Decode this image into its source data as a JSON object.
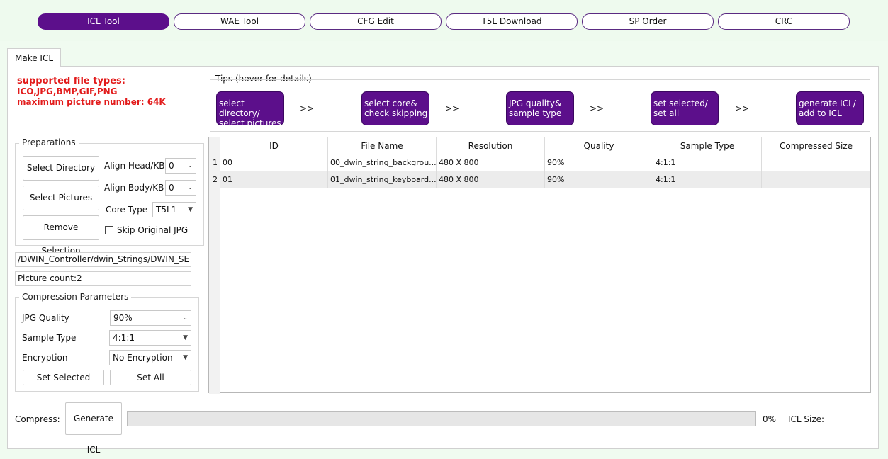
{
  "nav": {
    "items": [
      "ICL Tool",
      "WAE Tool",
      "CFG Edit",
      "T5L Download",
      "SP Order",
      "CRC"
    ],
    "active_index": 0
  },
  "tab": {
    "label": "Make ICL"
  },
  "info": {
    "line1": "supported file types:",
    "line2": "ICO,JPG,BMP,GIF,PNG",
    "line3": "maximum picture number: 64K"
  },
  "preparations": {
    "title": "Preparations",
    "select_directory": "Select Directory",
    "select_pictures": "Select Pictures",
    "remove_selection": "Remove Selection",
    "align_head_label": "Align Head/KB",
    "align_head_value": "0",
    "align_body_label": "Align Body/KB",
    "align_body_value": "0",
    "core_type_label": "Core Type",
    "core_type_value": "T5L1",
    "skip_jpg_label": "Skip Original JPG"
  },
  "path_value": "/DWIN_Controller/dwin_Strings/DWIN_SET",
  "picture_count": "Picture count:2",
  "compression": {
    "title": "Compression Parameters",
    "jpg_quality_label": "JPG Quality",
    "jpg_quality_value": "90%",
    "sample_type_label": "Sample Type",
    "sample_type_value": "4:1:1",
    "encryption_label": "Encryption",
    "encryption_value": "No Encryption",
    "set_selected": "Set Selected",
    "set_all": "Set All"
  },
  "tips": {
    "title": "Tips (hover for details)",
    "steps": [
      [
        "select directory/",
        "select pictures"
      ],
      [
        "select core&",
        "check skipping"
      ],
      [
        "JPG quality&",
        "sample type"
      ],
      [
        "set selected/",
        "set all"
      ],
      [
        "generate ICL/",
        "add to ICL"
      ]
    ],
    "arrow": ">>"
  },
  "table": {
    "columns": [
      "ID",
      "File Name",
      "Resolution",
      "Quality",
      "Sample Type",
      "Compressed Size"
    ],
    "rows": [
      {
        "num": "1",
        "id": "00",
        "file": "00_dwin_string_backgrou...",
        "res": "480 X 800",
        "quality": "90%",
        "sample": "4:1:1",
        "size": ""
      },
      {
        "num": "2",
        "id": "01",
        "file": "01_dwin_string_keyboard...",
        "res": "480 X 800",
        "quality": "90%",
        "sample": "4:1:1",
        "size": ""
      }
    ]
  },
  "footer": {
    "compress_label": "Compress:",
    "generate_button": "Generate ICL",
    "progress_percent": "0%",
    "progress_fraction": 0,
    "icl_size_label": "ICL Size:"
  }
}
